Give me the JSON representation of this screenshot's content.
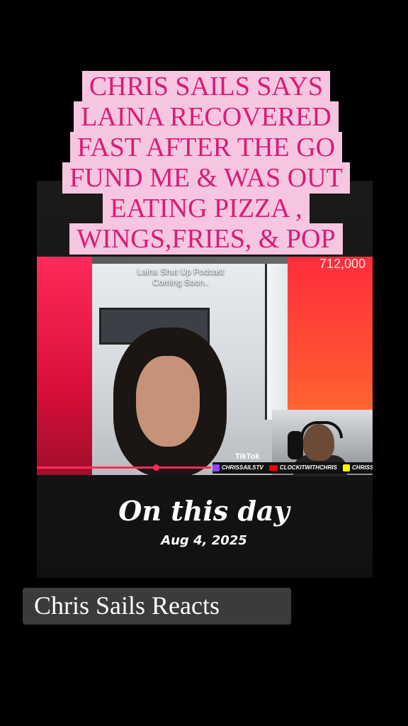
{
  "headline": {
    "lines": [
      "CHRIS SAILS SAYS",
      "LAINA RECOVERED",
      "FAST AFTER THE GO",
      "FUND ME & WAS OUT",
      "EATING PIZZA ,",
      "WINGS,FRIES, & POP"
    ],
    "text_color": "#d81c78",
    "bg_color": "#f6c6e0"
  },
  "video": {
    "overlay_line1": "Laina Shut Up Podcast",
    "overlay_line2": "Coming Soon..",
    "counter": "712,000",
    "tiktok_label": "TikTok",
    "ticker": {
      "twitch": "CHRISSAILSTV",
      "youtube": "CLOCKITWITHCHRIS",
      "snapchat": "CHRISSAILS"
    },
    "progress_color": "#ff2d55"
  },
  "memory": {
    "title": "On this day",
    "date": "Aug 4, 2025"
  },
  "caption": {
    "label": "Chris Sails Reacts"
  }
}
